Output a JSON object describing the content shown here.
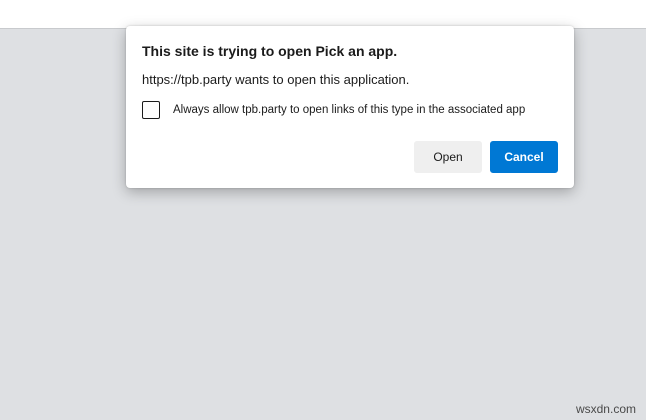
{
  "dialog": {
    "title": "This site is trying to open Pick an app.",
    "message": "https://tpb.party wants to open this application.",
    "checkbox": {
      "label": "Always allow tpb.party to open links of this type in the associated app",
      "checked": false
    },
    "open_label": "Open",
    "cancel_label": "Cancel"
  },
  "watermark": "wsxdn.com",
  "colors": {
    "accent": "#0078d4",
    "page_background": "#dee0e3",
    "dialog_background": "#ffffff",
    "secondary_button": "#efefef"
  }
}
